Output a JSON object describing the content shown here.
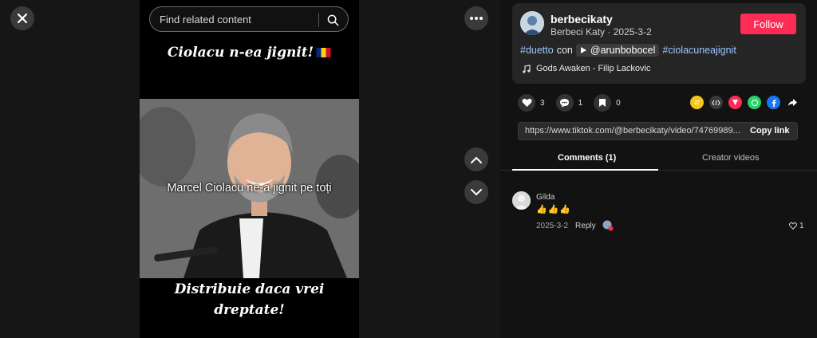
{
  "search": {
    "placeholder": "Find related content"
  },
  "video": {
    "title_text": "Ciolacu n-ea jignit!",
    "overlay_text": "Marcel Ciolacu ne-a jignit pe toți",
    "bottom_line1": "Distribuie daca vrei",
    "bottom_line2": "dreptate!"
  },
  "author": {
    "username": "berbecikaty",
    "display_name": "Berbeci Katy",
    "date": "2025-3-2",
    "separator": " · ",
    "follow_label": "Follow"
  },
  "description": {
    "tag1": "#duetto",
    "con_word": "con",
    "mention": "@arunbobocel",
    "tag2": "#ciolacuneajignit"
  },
  "music": {
    "label": "Gods Awaken - Filip Lackovic"
  },
  "stats": {
    "likes": "3",
    "comments": "1",
    "saves": "0"
  },
  "link": {
    "url": "https://www.tiktok.com/@berbecikaty/video/74769989...",
    "copy_label": "Copy link"
  },
  "tabs": {
    "comments_label": "Comments (1)",
    "creator_label": "Creator videos"
  },
  "comment": {
    "author": "Gilda",
    "text": "👍👍👍",
    "date": "2025-3-2",
    "reply_label": "Reply",
    "likes": "1"
  },
  "colors": {
    "accent": "#fe2c55",
    "hashtag": "#9dc5ff",
    "panel_bg": "#121212",
    "card_bg": "#252525"
  }
}
